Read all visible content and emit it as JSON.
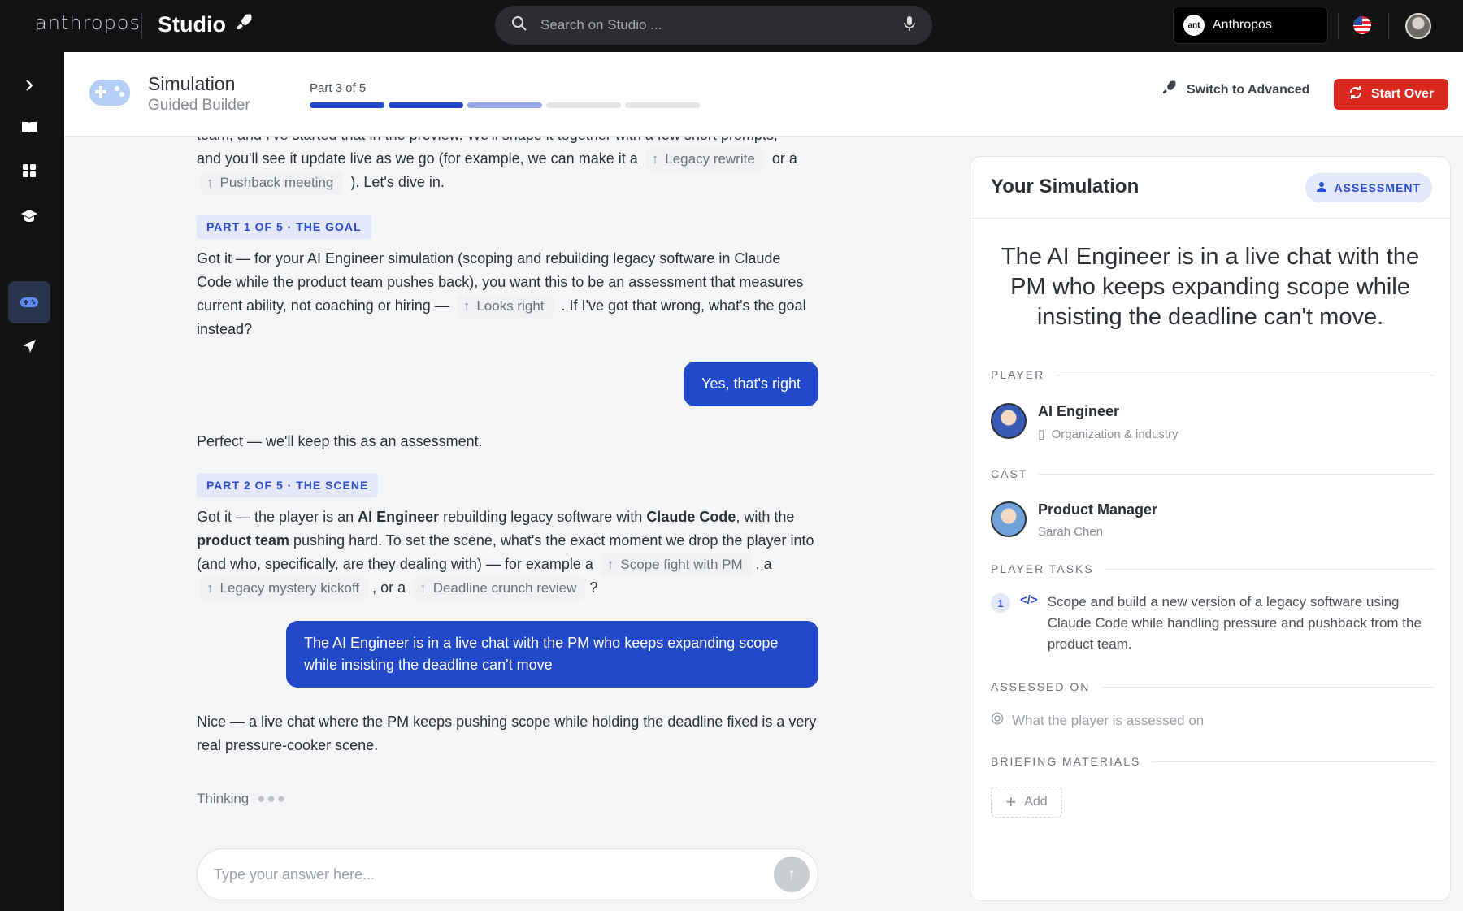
{
  "topbar": {
    "brand": "anthropos",
    "studio_label": "Studio",
    "search_placeholder": "Search on Studio ...",
    "org_name": "Anthropos",
    "org_logo_text": "ant"
  },
  "rail": {
    "icons": [
      "chevron-right-icon",
      "book-icon",
      "grid-icon",
      "graduation-cap-icon",
      "gamepad-icon",
      "send-icon"
    ],
    "active": "gamepad-icon"
  },
  "header": {
    "title": "Simulation",
    "subtitle": "Guided Builder",
    "progress_label": "Part 3 of 5",
    "progress": {
      "current": 3,
      "total": 5
    },
    "switch_label": "Switch to Advanced",
    "start_over_label": "Start Over"
  },
  "chat": {
    "intro_top": "team, and I've started that in the preview. We'll shape it together with a few short prompts,",
    "intro_line2": "and you'll see it update live as we go (for example, we can make it a",
    "chip_legacy_rewrite": "Legacy rewrite",
    "or_a": "or a",
    "chip_pushback": "Pushback meeting",
    "intro_end": "). Let's dive in.",
    "part1_tag": "PART 1 OF 5 · THE GOAL",
    "part1_text": "Got it — for your AI Engineer simulation (scoping and rebuilding legacy software in Claude Code while the product team pushes back), you want this to be an assessment that measures current ability, not coaching or hiring —",
    "chip_looks_right": "Looks right",
    "part1_end": ". If I've got that wrong, what's the goal instead?",
    "user_reply1": "Yes, that's right",
    "perfect": "Perfect — we'll keep this as an assessment.",
    "part2_tag": "PART 2 OF 5 · THE SCENE",
    "part2_a": "Got it — the player is an",
    "part2_b": "AI Engineer",
    "part2_c": "rebuilding legacy software with",
    "part2_d": "Claude Code",
    "part2_e": ", with the",
    "part2_f": "product team",
    "part2_g": "pushing hard. To set the scene, what's the exact moment we drop the player into (and who, specifically, are they dealing with) — for example a",
    "chip_scope": "Scope fight with PM",
    "comma_a": ", a",
    "chip_mystery": "Legacy mystery kickoff",
    "comma_or_a": ", or a",
    "chip_deadline": "Deadline crunch review",
    "question": "?",
    "user_reply2": "The AI Engineer is in a live chat with the PM who keeps expanding scope while insisting the deadline can't move",
    "nice": "Nice — a live chat where the PM keeps pushing scope while holding the deadline fixed is a very real pressure-cooker scene.",
    "thinking": "Thinking",
    "answer_placeholder": "Type your answer here..."
  },
  "panel": {
    "title": "Your Simulation",
    "badge": "ASSESSMENT",
    "headline": "The AI Engineer is in a live chat with the PM who keeps expanding scope while insisting the deadline can't move.",
    "player_section": "PLAYER",
    "player_name": "AI Engineer",
    "player_sub": "Organization & industry",
    "cast_section": "CAST",
    "cast_role": "Product Manager",
    "cast_name": "Sarah Chen",
    "tasks_section": "PLAYER TASKS",
    "task_number": "1",
    "task_text": "Scope and build a new version of a legacy software using Claude Code while handling pressure and pushback from the product team.",
    "assessed_section": "ASSESSED ON",
    "assessed_placeholder": "What the player is assessed on",
    "briefing_section": "BRIEFING MATERIALS",
    "add_label": "Add"
  },
  "colors": {
    "accent": "#2149c9",
    "danger": "#d9281f",
    "dark": "#111214"
  }
}
